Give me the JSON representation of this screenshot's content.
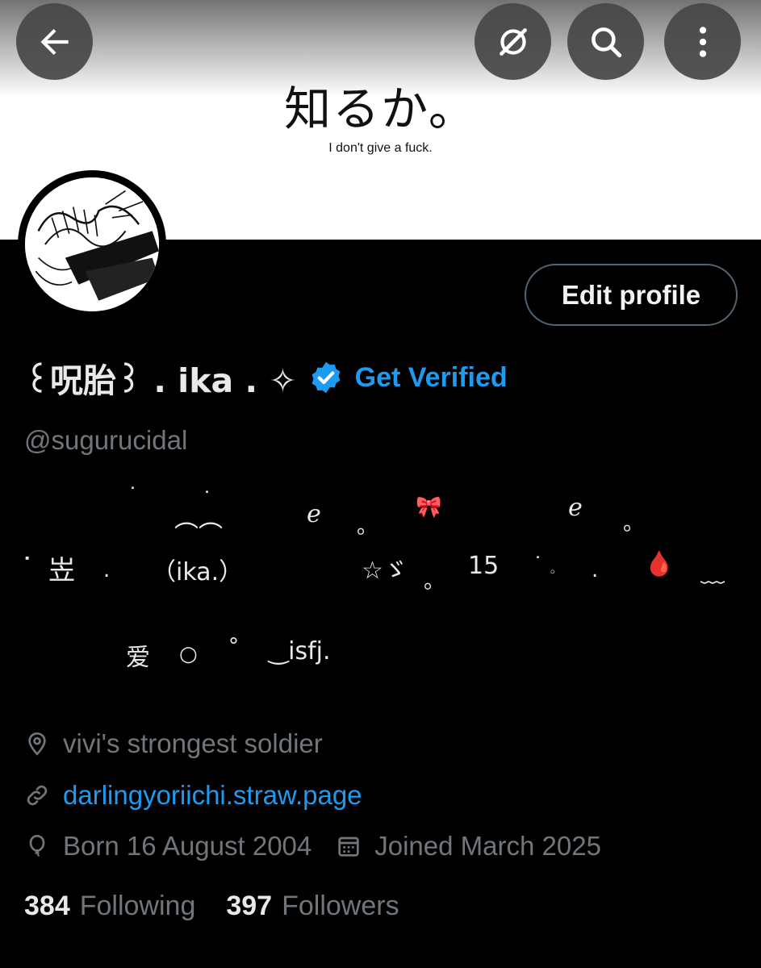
{
  "banner": {
    "japanese_text": "知るか。",
    "english_text": "I don't give a fuck."
  },
  "header_buttons": {
    "back_icon": "arrow-left-icon",
    "grok_icon": "grok-icon",
    "search_icon": "search-icon",
    "more_icon": "more-vertical-icon"
  },
  "profile": {
    "edit_profile_label": "Edit profile",
    "display_name": "꒰呪胎꒱ . ika . ✧",
    "get_verified_label": "Get Verified",
    "handle": "@sugurucidal",
    "accent_color": "#1d9bf0"
  },
  "bio": {
    "l1_a": "˙",
    "l1_b": "˙",
    "l1_c": "︵︵",
    "l1_d": "ℯ",
    "l1_e": "。",
    "l1_f": "🎀",
    "l1_g": "ℯ",
    "l1_h": "。",
    "l2_a": "⠂",
    "l2_b": "岦",
    "l2_c": ".",
    "l2_d": "（ika.）",
    "l2_e": "☆ゞ",
    "l2_f": "。",
    "l2_g": "15",
    "l2_h": "˙ 𓈒",
    "l2_i": ".",
    "l2_j": "🩸",
    "l2_k": "﹏",
    "l3_a": "爱",
    "l3_b": "○",
    "l3_c": "°",
    "l3_d": "‿isfj."
  },
  "meta": {
    "location": "vivi's strongest soldier",
    "website": "darlingyoriichi.straw.page",
    "born": "Born 16 August 2004",
    "joined": "Joined March 2025"
  },
  "stats": {
    "following_count": "384",
    "following_label": "Following",
    "followers_count": "397",
    "followers_label": "Followers"
  }
}
